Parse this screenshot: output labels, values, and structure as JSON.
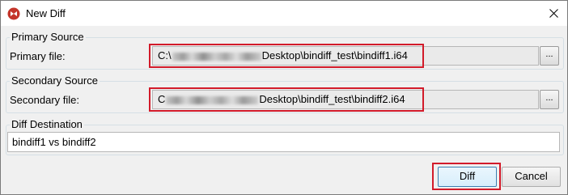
{
  "window": {
    "title": "New Diff"
  },
  "primary": {
    "group_title": "Primary Source",
    "label": "Primary file:",
    "path_prefix": "C:\\",
    "path_suffix": "Desktop\\bindiff_test\\bindiff1.i64",
    "browse_label": "..."
  },
  "secondary": {
    "group_title": "Secondary Source",
    "label": "Secondary file:",
    "path_prefix": "C",
    "path_suffix": "Desktop\\bindiff_test\\bindiff2.i64",
    "browse_label": "..."
  },
  "destination": {
    "group_title": "Diff Destination",
    "value": "bindiff1 vs bindiff2"
  },
  "buttons": {
    "diff": "Diff",
    "cancel": "Cancel"
  },
  "colors": {
    "highlight": "#d21b2a",
    "accent": "#3c7fb1"
  },
  "icons": {
    "app": "bindiff-logo-icon",
    "close": "close-icon",
    "browse": "ellipsis-icon"
  }
}
